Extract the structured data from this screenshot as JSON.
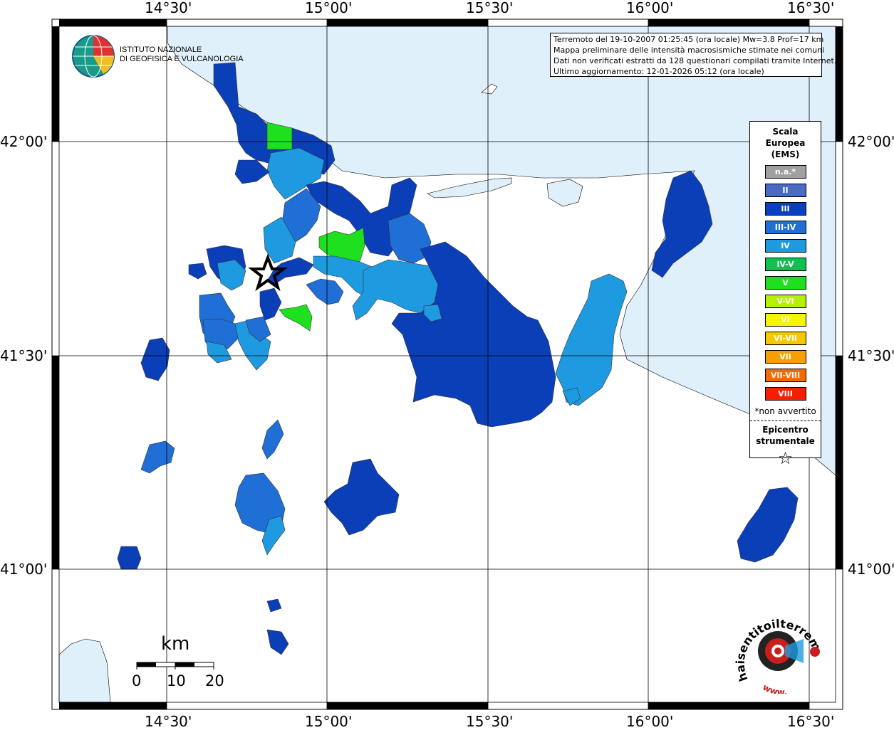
{
  "map": {
    "lon_labels": [
      "14°30'",
      "15°00'",
      "15°30'",
      "16°00'",
      "16°30'"
    ],
    "lat_labels": [
      "42°00'",
      "41°30'",
      "41°00'"
    ]
  },
  "info": {
    "line1": "Terremoto del 19-10-2007 01:25:45 (ora locale) Mw=3.8 Prof=17 km",
    "line2": "Mappa preliminare delle intensità macrosismiche stimate nei comuni",
    "line3": "Dati non verificati estratti da 128 questionari compilati tramite Internet.",
    "line4": "Ultimo aggiornamento: 12-01-2026 05:12 (ora locale)"
  },
  "logo": {
    "line1": "ISTITUTO NAZIONALE",
    "line2": "DI GEOFISICA E VULCANOLOGIA"
  },
  "legend": {
    "title1": "Scala",
    "title2": "Europea",
    "title3": "(EMS)",
    "items": [
      {
        "label": "n.a.*",
        "color": "#a0a0a0"
      },
      {
        "label": "II",
        "color": "#4a6bc4"
      },
      {
        "label": "III",
        "color": "#0a3fc4"
      },
      {
        "label": "III-IV",
        "color": "#1f6fd6"
      },
      {
        "label": "IV",
        "color": "#1e9be0"
      },
      {
        "label": "IV-V",
        "color": "#10c050"
      },
      {
        "label": "V",
        "color": "#1ee01e"
      },
      {
        "label": "V-VI",
        "color": "#b4f000"
      },
      {
        "label": "VI",
        "color": "#f5f500"
      },
      {
        "label": "VI-VII",
        "color": "#f5c800"
      },
      {
        "label": "VII",
        "color": "#f5a000"
      },
      {
        "label": "VII-VIII",
        "color": "#f56a00"
      },
      {
        "label": "VIII",
        "color": "#f51e00"
      }
    ],
    "note": "*non avvertito",
    "epi1": "Epicentro",
    "epi2": "strumentale"
  },
  "scale": {
    "unit": "km",
    "ticks": [
      "0",
      "10",
      "20"
    ]
  },
  "colors": {
    "sea": "#dff0fb",
    "II": "#4a6bc4",
    "III": "#0a3fb8",
    "III_IV": "#1f6fd6",
    "IV": "#1e9be0",
    "V": "#1ee01e"
  },
  "watermark": {
    "text1": "haisentitoilterremoto.it",
    "text2": "www."
  }
}
